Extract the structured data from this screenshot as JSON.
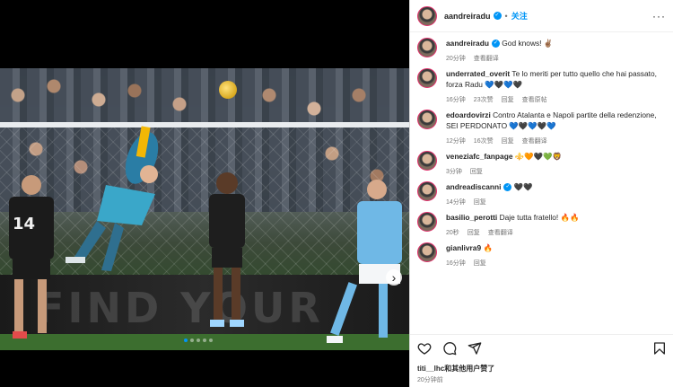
{
  "post": {
    "author": "aandreiradu",
    "follow_label": "关注",
    "separator": "•",
    "more_glyph": "···",
    "ad_text": "FIND YOUR",
    "carousel": {
      "total": 5,
      "active": 0
    },
    "player_number": "14"
  },
  "comments": [
    {
      "username": "aandreiradu",
      "verified": true,
      "text": "God knows! ✌🏽",
      "time": "20分钟",
      "likes": "",
      "reply": "",
      "translate": "查看翻译"
    },
    {
      "username": "underrated_overit",
      "verified": false,
      "text": "Te lo meriti per tutto quello che hai passato, forza Radu 💙🖤💙🖤",
      "time": "16分钟",
      "likes": "23次赞",
      "reply": "回复",
      "translate": "查看原帖"
    },
    {
      "username": "edoardovirzi",
      "verified": false,
      "text": "Contro Atalanta e Napoli partite della redenzione, SEI PERDONATO 💙🖤💙🖤💙",
      "time": "12分钟",
      "likes": "16次赞",
      "reply": "回复",
      "translate": "查看翻译"
    },
    {
      "username": "veneziafc_fanpage",
      "verified": false,
      "text": "⚜️🧡🖤💚🦁",
      "time": "3分钟",
      "likes": "",
      "reply": "回复",
      "translate": ""
    },
    {
      "username": "andreadiscanni",
      "verified": true,
      "text": "🖤🖤",
      "time": "14分钟",
      "likes": "",
      "reply": "回复",
      "translate": ""
    },
    {
      "username": "basilio_perotti",
      "verified": false,
      "text": "Daje tutta fratello! 🔥🔥",
      "time": "20秒",
      "likes": "",
      "reply": "回复",
      "translate": "查看翻译"
    },
    {
      "username": "gianlivra9",
      "verified": false,
      "text": "🔥",
      "time": "16分钟",
      "likes": "",
      "reply": "回复",
      "translate": ""
    }
  ],
  "footer": {
    "liked_by_user": "titi__lhc",
    "liked_by_rest": "和其他用户赞了",
    "time_ago": "20分钟前"
  },
  "icons": {
    "like": "heart-icon",
    "comment": "comment-icon",
    "share": "share-icon",
    "save": "bookmark-icon"
  },
  "colors": {
    "accent": "#0095f6",
    "story_ring": "#e1306c"
  }
}
